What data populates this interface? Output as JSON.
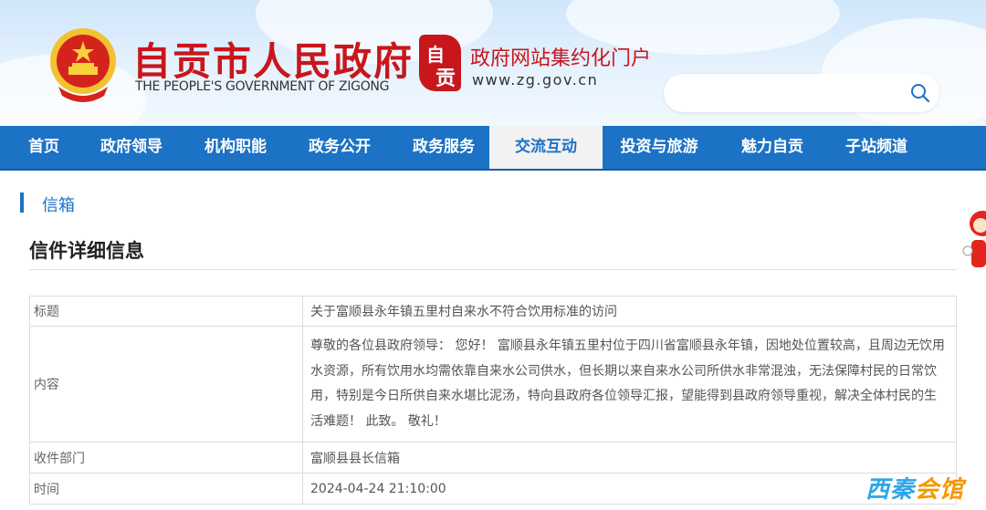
{
  "header": {
    "title": "自贡市人民政府",
    "title_en": "THE PEOPLE'S GOVERNMENT OF ZIGONG",
    "portal_name": "政府网站集约化门户",
    "portal_url": "www.zg.gov.cn",
    "seal_chars": [
      "自",
      "贡"
    ],
    "search": {
      "value": "",
      "placeholder": ""
    }
  },
  "nav": {
    "items": [
      {
        "label": "首页"
      },
      {
        "label": "政府领导"
      },
      {
        "label": "机构职能"
      },
      {
        "label": "政务公开"
      },
      {
        "label": "政务服务"
      },
      {
        "label": "交流互动",
        "active": true
      },
      {
        "label": "投资与旅游"
      },
      {
        "label": "魅力自贡"
      },
      {
        "label": "子站频道"
      }
    ]
  },
  "section": {
    "title": "信箱"
  },
  "detail": {
    "page_title": "信件详细信息",
    "rows": [
      {
        "label": "标题",
        "value": "关于富顺县永年镇五里村自来水不符合饮用标准的访问"
      },
      {
        "label": "内容",
        "value": "尊敬的各位县政府领导： 您好！ 富顺县永年镇五里村位于四川省富顺县永年镇，因地处位置较高，且周边无饮用水资源，所有饮用水均需依靠自来水公司供水，但长期以来自来水公司所供水非常混浊，无法保障村民的日常饮用，特别是今日所供自来水堪比泥汤，特向县政府各位领导汇报，望能得到县政府领导重视，解决全体村民的生活难题！ 此致。 敬礼！"
      },
      {
        "label": "收件部门",
        "value": "富顺县县长信箱"
      },
      {
        "label": "时间",
        "value": "2024-04-24 21:10:00"
      }
    ]
  },
  "watermark": {
    "part1": "西秦",
    "part2": "会馆"
  },
  "colors": {
    "brand_red": "#c8161d",
    "nav_blue": "#1c72c4",
    "watermark_blue": "#2da6e6",
    "watermark_orange": "#f39800"
  }
}
